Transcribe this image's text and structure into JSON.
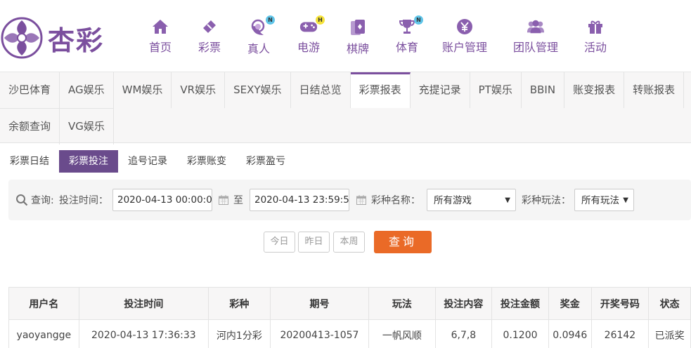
{
  "brand": {
    "name": "杏彩",
    "color": "#7b4f9e"
  },
  "nav": [
    {
      "label": "首页",
      "icon": "home-icon"
    },
    {
      "label": "彩票",
      "icon": "lottery-ticket-icon"
    },
    {
      "label": "真人",
      "icon": "live-dealer-icon",
      "badge": "N",
      "badge_color": "#5fc4e8"
    },
    {
      "label": "电游",
      "icon": "gamepad-icon",
      "badge": "H",
      "badge_color": "#f5e23a"
    },
    {
      "label": "棋牌",
      "icon": "cards-icon"
    },
    {
      "label": "体育",
      "icon": "trophy-icon",
      "badge": "N",
      "badge_color": "#5fc4e8"
    },
    {
      "label": "账户管理",
      "icon": "yen-icon"
    },
    {
      "label": "团队管理",
      "icon": "team-icon"
    },
    {
      "label": "活动",
      "icon": "gift-icon"
    }
  ],
  "tabs_row1": [
    "沙巴体育",
    "AG娱乐",
    "WM娱乐",
    "VR娱乐",
    "SEXY娱乐",
    "日结总览",
    "彩票报表",
    "充提记录",
    "PT娱乐",
    "BBIN",
    "账变报表",
    "转账报表"
  ],
  "tabs_row2": [
    "余额查询",
    "VG娱乐"
  ],
  "active_tab": "彩票报表",
  "subtabs": [
    "彩票日结",
    "彩票投注",
    "追号记录",
    "彩票账变",
    "彩票盈亏"
  ],
  "active_subtab": "彩票投注",
  "query": {
    "label": "查询:",
    "time_label": "投注时间：",
    "start_time": "2020-04-13 00:00:00",
    "to_label": "至",
    "end_time": "2020-04-13 23:59:59",
    "game_label": "彩种名称：",
    "game_value": "所有游戏",
    "play_label": "彩种玩法：",
    "play_value": "所有玩法"
  },
  "quick_buttons": {
    "today": "今日",
    "yesterday": "昨日",
    "week": "本周"
  },
  "search_button": "查询",
  "table": {
    "headers": [
      "用户名",
      "投注时间",
      "彩种",
      "期号",
      "玩法",
      "投注内容",
      "投注金额",
      "奖金",
      "开奖号码",
      "状态"
    ],
    "rows": [
      [
        "yaoyangge",
        "2020-04-13 17:36:33",
        "河内1分彩",
        "20200413-1057",
        "一帆风顺",
        "6,7,8",
        "0.1200",
        "0.0946",
        "26142",
        "已派奖"
      ]
    ]
  },
  "colors": {
    "accent": "#7b4f9e",
    "subtab_active": "#6a4b8c",
    "search": "#ea6a27",
    "status_paid": "#e0762e"
  }
}
